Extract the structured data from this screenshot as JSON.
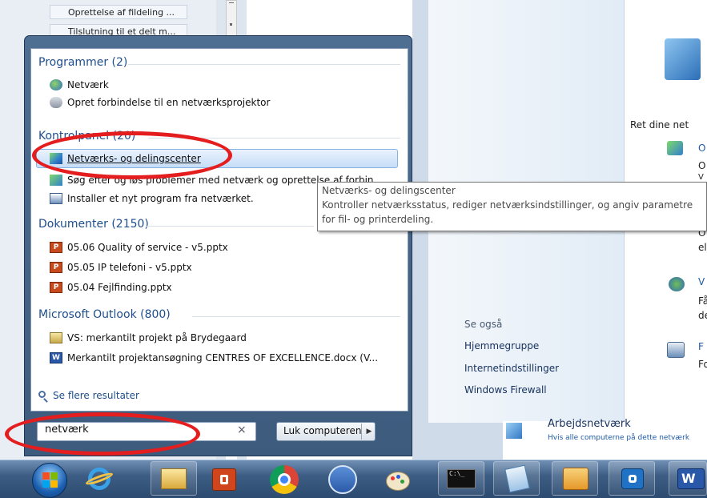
{
  "background_explorer": {
    "tree_items": [
      "Oprettelse af fildeling ...",
      "Tilslutning til et delt m..."
    ]
  },
  "control_panel": {
    "header_text": "Ret dine net",
    "task_links": [
      "O",
      "V",
      "F"
    ],
    "task_descs": [
      "O",
      "V",
      "O",
      "el",
      "Få",
      "de",
      "Fo"
    ],
    "see_also_heading": "Se også",
    "see_also_links": [
      "Hjemmegruppe",
      "Internetindstillinger",
      "Windows Firewall"
    ],
    "bottom_title": "Arbejdsnetværk",
    "bottom_desc": "Hvis alle computerne på dette netværk"
  },
  "start_menu": {
    "groups": {
      "programs": "Programmer (2)",
      "control_panel": "Kontrolpanel (20)",
      "documents": "Dokumenter (2150)",
      "outlook": "Microsoft Outlook (800)"
    },
    "programs_items": [
      "Netværk",
      "Opret forbindelse til en netværksprojektor"
    ],
    "control_panel_items": [
      "Netværks- og delingscenter",
      "Søg efter og løs problemer med netværk og oprettelse af forbin...",
      "Installer et nyt program fra netværket."
    ],
    "documents_items": [
      "05.06 Quality of service - v5.pptx",
      "05.05 IP telefoni - v5.pptx",
      "05.04 Fejlfinding.pptx"
    ],
    "outlook_items": [
      "VS: merkantilt projekt på Brydegaard",
      "Merkantilt projektansøgning CENTRES OF EXCELLENCE.docx (V..."
    ],
    "more_results": "Se flere resultater",
    "search_value": "netværk",
    "search_clear": "×",
    "shutdown_label": "Luk computeren",
    "shutdown_arrow": "▶"
  },
  "tooltip": {
    "title": "Netværks- og delingscenter",
    "line1": "Kontroller netværksstatus, rediger netværksindstillinger, og angiv parametre",
    "line2": "for fil- og printerdeling."
  },
  "doc_badges": {
    "ppt": "P",
    "word": "W"
  },
  "taskbar": {
    "items": [
      "start-orb-icon",
      "internet-explorer-icon",
      "file-explorer-icon",
      "powerpoint-icon",
      "chrome-icon",
      "skype-icon",
      "paint-icon",
      "command-prompt-icon",
      "notepad-icon",
      "outlook-icon",
      "outlook-express-icon",
      "word-icon"
    ],
    "cmd_label": "C:\\_",
    "word_label": "W"
  },
  "colors": {
    "group_heading": "#1e4e8c",
    "annotation": "#e41e1e",
    "selection": "#c6ddf7",
    "taskbar": "#3d5d84"
  }
}
